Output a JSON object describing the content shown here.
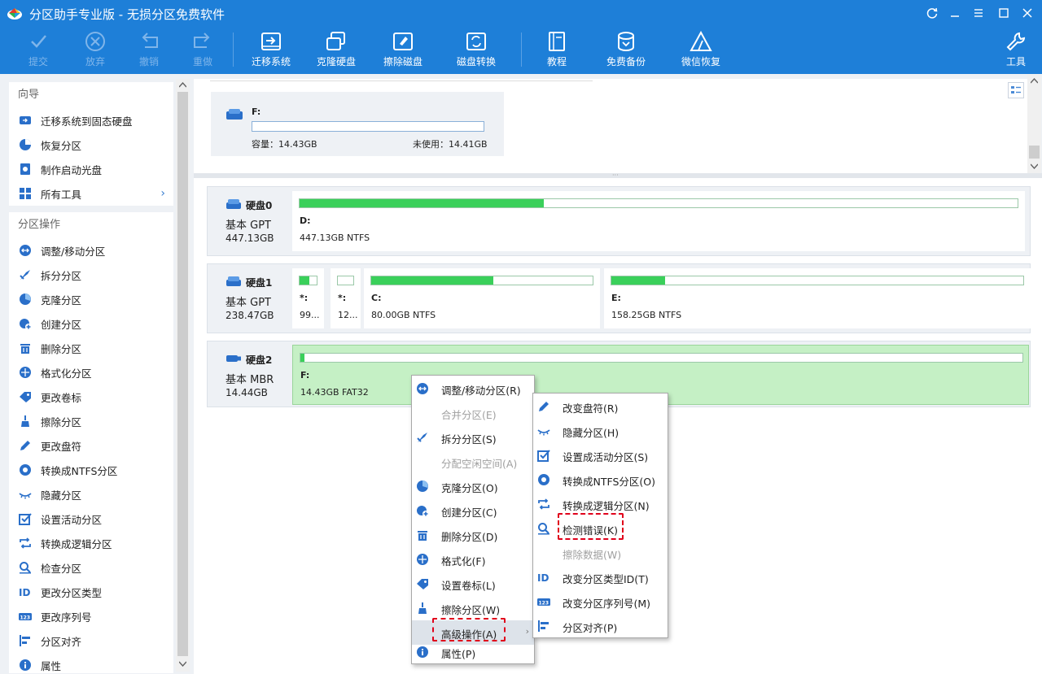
{
  "window": {
    "title": "分区助手专业版 - 无损分区免费软件",
    "controls": [
      "refresh-icon",
      "minimize-icon",
      "menu-icon",
      "maximize-icon",
      "close-icon"
    ]
  },
  "toolbar": {
    "commit": "提交",
    "discard": "放弃",
    "undo": "撤销",
    "redo": "重做",
    "migrate_os": "迁移系统",
    "clone_disk": "克隆硬盘",
    "wipe_disk": "擦除磁盘",
    "convert_disk": "磁盘转换",
    "tutorial": "教程",
    "free_backup": "免费备份",
    "wechat_restore": "微信恢复",
    "tools": "工具"
  },
  "sidebar": {
    "wizard_title": "向导",
    "wizard_items": [
      {
        "label": "迁移系统到固态硬盘",
        "icon": "migrate-icon"
      },
      {
        "label": "恢复分区",
        "icon": "recover-icon"
      },
      {
        "label": "制作启动光盘",
        "icon": "bootdisk-icon"
      },
      {
        "label": "所有工具",
        "icon": "tools-grid-icon"
      }
    ],
    "ops_title": "分区操作",
    "ops_items": [
      {
        "label": "调整/移动分区",
        "icon": "resize-icon"
      },
      {
        "label": "拆分分区",
        "icon": "split-icon"
      },
      {
        "label": "克隆分区",
        "icon": "clone-icon"
      },
      {
        "label": "创建分区",
        "icon": "create-icon"
      },
      {
        "label": "删除分区",
        "icon": "delete-icon"
      },
      {
        "label": "格式化分区",
        "icon": "format-icon"
      },
      {
        "label": "更改卷标",
        "icon": "label-icon"
      },
      {
        "label": "擦除分区",
        "icon": "wipe-icon"
      },
      {
        "label": "更改盘符",
        "icon": "pencil-icon"
      },
      {
        "label": "转换成NTFS分区",
        "icon": "convert-icon"
      },
      {
        "label": "隐藏分区",
        "icon": "hide-icon"
      },
      {
        "label": "设置活动分区",
        "icon": "active-icon"
      },
      {
        "label": "转换成逻辑分区",
        "icon": "logical-icon"
      },
      {
        "label": "检查分区",
        "icon": "check-icon"
      },
      {
        "label": "更改分区类型",
        "icon": "id-icon"
      },
      {
        "label": "更改序列号",
        "icon": "serial-icon"
      },
      {
        "label": "分区对齐",
        "icon": "align-icon"
      },
      {
        "label": "属性",
        "icon": "info-icon"
      }
    ]
  },
  "top_card": {
    "letter": "F:",
    "capacity": "容量：14.43GB",
    "unused": "未使用：14.41GB"
  },
  "disks": [
    {
      "name": "硬盘0",
      "type": "基本 GPT",
      "size": "447.13GB",
      "partitions": [
        {
          "label": "D:",
          "info": "447.13GB NTFS",
          "used": 0.34
        }
      ]
    },
    {
      "name": "硬盘1",
      "type": "基本 GPT",
      "size": "238.47GB",
      "partitions": [
        {
          "label": "*:",
          "info": "99...",
          "used": 0.55
        },
        {
          "label": "*:",
          "info": "12...",
          "used": 0.0
        },
        {
          "label": "C:",
          "info": "80.00GB NTFS",
          "used": 0.55
        },
        {
          "label": "E:",
          "info": "158.25GB NTFS",
          "used": 0.13
        }
      ]
    },
    {
      "name": "硬盘2",
      "type": "基本 MBR",
      "size": "14.44GB",
      "partitions": [
        {
          "label": "F:",
          "info": "14.43GB FAT32",
          "used": 0.004,
          "selected": true
        }
      ]
    }
  ],
  "context_menu": [
    {
      "label": "调整/移动分区(R)",
      "icon": "resize-icon",
      "enabled": true
    },
    {
      "label": "合并分区(E)",
      "icon": "",
      "enabled": false
    },
    {
      "label": "拆分分区(S)",
      "icon": "split-icon",
      "enabled": true
    },
    {
      "label": "分配空闲空间(A)",
      "icon": "",
      "enabled": false
    },
    {
      "label": "克隆分区(O)",
      "icon": "clone-icon",
      "enabled": true
    },
    {
      "label": "创建分区(C)",
      "icon": "create-icon",
      "enabled": true
    },
    {
      "label": "删除分区(D)",
      "icon": "delete-icon",
      "enabled": true
    },
    {
      "label": "格式化(F)",
      "icon": "format-icon",
      "enabled": true
    },
    {
      "label": "设置卷标(L)",
      "icon": "label-icon",
      "enabled": true
    },
    {
      "label": "擦除分区(W)",
      "icon": "wipe-icon",
      "enabled": true
    },
    {
      "label": "高级操作(A)",
      "icon": "",
      "enabled": true,
      "highlighted": true,
      "submenu": true
    },
    {
      "label": "属性(P)",
      "icon": "info-icon",
      "enabled": true
    }
  ],
  "submenu": [
    {
      "label": "改变盘符(R)",
      "icon": "pencil-icon",
      "enabled": true
    },
    {
      "label": "隐藏分区(H)",
      "icon": "hide-icon",
      "enabled": true
    },
    {
      "label": "设置成活动分区(S)",
      "icon": "active-icon",
      "enabled": true
    },
    {
      "label": "转换成NTFS分区(O)",
      "icon": "convert-icon",
      "enabled": true
    },
    {
      "label": "转换成逻辑分区(N)",
      "icon": "logical-icon",
      "enabled": true
    },
    {
      "label": "检测错误(K)",
      "icon": "check-icon",
      "enabled": true
    },
    {
      "label": "擦除数据(W)",
      "icon": "",
      "enabled": false
    },
    {
      "label": "改变分区类型ID(T)",
      "icon": "id-icon",
      "enabled": true
    },
    {
      "label": "改变分区序列号(M)",
      "icon": "serial-icon",
      "enabled": true
    },
    {
      "label": "分区对齐(P)",
      "icon": "align-icon",
      "enabled": true
    }
  ],
  "colors": {
    "titlebar": "#1e7fd8",
    "accent": "#2a6fc9",
    "partition_used": "#3ad05a",
    "selected_partition": "#c5f0c5",
    "annotation_dash": "#e0001b"
  }
}
